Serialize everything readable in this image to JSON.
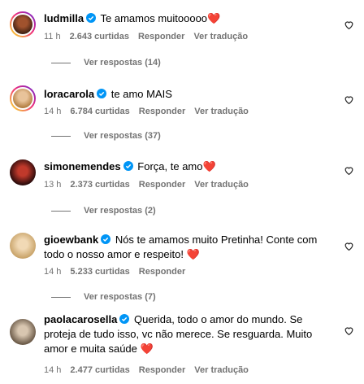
{
  "comments": [
    {
      "username": "ludmilla",
      "text": "Te amamos muitooooo❤️",
      "time": "11 h",
      "likes": "2.643 curtidas",
      "reply_label": "Responder",
      "translate_label": "Ver tradução",
      "view_replies": "Ver respostas (14)",
      "has_story_ring": true
    },
    {
      "username": "loracarola",
      "text": "te amo MAIS",
      "time": "14 h",
      "likes": "6.784 curtidas",
      "reply_label": "Responder",
      "translate_label": "Ver tradução",
      "view_replies": "Ver respostas (37)",
      "has_story_ring": true
    },
    {
      "username": "simonemendes",
      "text": "Força, te amo❤️",
      "time": "13 h",
      "likes": "2.373 curtidas",
      "reply_label": "Responder",
      "translate_label": "Ver tradução",
      "view_replies": "Ver respostas (2)",
      "has_story_ring": false
    },
    {
      "username": "gioewbank",
      "text": "Nós te amamos muito Pretinha! Conte com todo o nosso amor e respeito! ❤️",
      "time": "14 h",
      "likes": "5.233 curtidas",
      "reply_label": "Responder",
      "view_replies": "Ver respostas (7)",
      "has_story_ring": false
    },
    {
      "username": "paolacarosella",
      "text": "Querida, todo o amor do mundo. Se proteja de tudo isso, vc não merece. Se resguarda. Muito amor e muita saúde ❤️",
      "time": "14 h",
      "likes": "2.477 curtidas",
      "reply_label": "Responder",
      "translate_label": "Ver tradução",
      "has_story_ring": false
    }
  ],
  "icons": {
    "verified": "verified-badge-icon",
    "like": "heart-outline-icon"
  },
  "colors": {
    "verified": "#0095f6",
    "secondary_text": "#737373"
  }
}
